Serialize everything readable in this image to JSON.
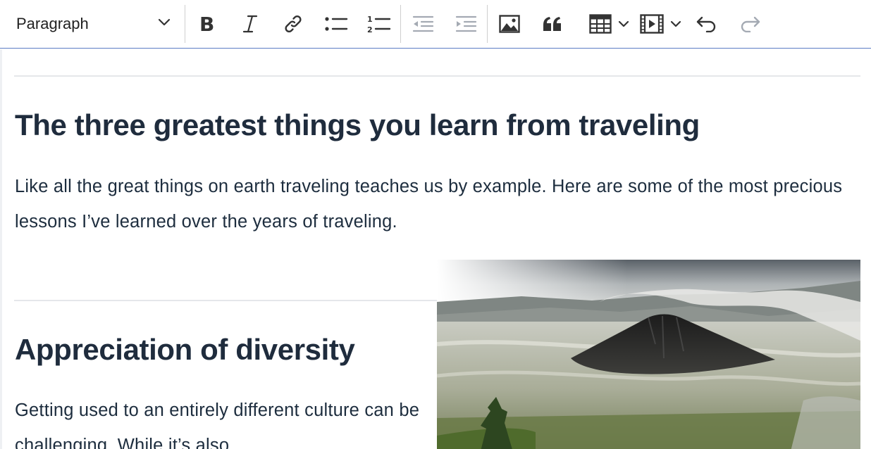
{
  "toolbar": {
    "heading_dropdown": {
      "selected": "Paragraph"
    },
    "buttons": [
      {
        "name": "bold",
        "icon": "bold-icon"
      },
      {
        "name": "italic",
        "icon": "italic-icon"
      },
      {
        "name": "link",
        "icon": "link-icon"
      },
      {
        "name": "bulleted-list",
        "icon": "bulleted-list-icon"
      },
      {
        "name": "numbered-list",
        "icon": "numbered-list-icon"
      },
      {
        "name": "outdent",
        "icon": "outdent-icon",
        "disabled": true
      },
      {
        "name": "indent",
        "icon": "indent-icon",
        "disabled": true
      },
      {
        "name": "insert-image",
        "icon": "image-icon"
      },
      {
        "name": "block-quote",
        "icon": "quote-icon"
      },
      {
        "name": "insert-table",
        "icon": "table-icon",
        "has_dropdown": true
      },
      {
        "name": "insert-media",
        "icon": "media-icon",
        "has_dropdown": true
      },
      {
        "name": "undo",
        "icon": "undo-icon"
      },
      {
        "name": "redo",
        "icon": "redo-icon",
        "disabled": true
      }
    ],
    "colors": {
      "icon": "#333333",
      "disabled_icon": "#a4aab3",
      "bottom_border": "#5c7cc4"
    }
  },
  "document": {
    "section1": {
      "heading": "The three greatest things you learn from traveling",
      "paragraph": "Like all the great things on earth traveling teaches us by example. Here are some of the most precious lessons I’ve learned over the years of traveling."
    },
    "section2": {
      "heading": "Appreciation of diversity",
      "paragraph": "Getting used to an entirely different culture can be challenging. While it’s also"
    },
    "image": {
      "subject": "volcano-landscape"
    },
    "colors": {
      "text": "#1d2d3e",
      "heading": "#1f2c3d",
      "rule": "#e5e7ea"
    }
  }
}
